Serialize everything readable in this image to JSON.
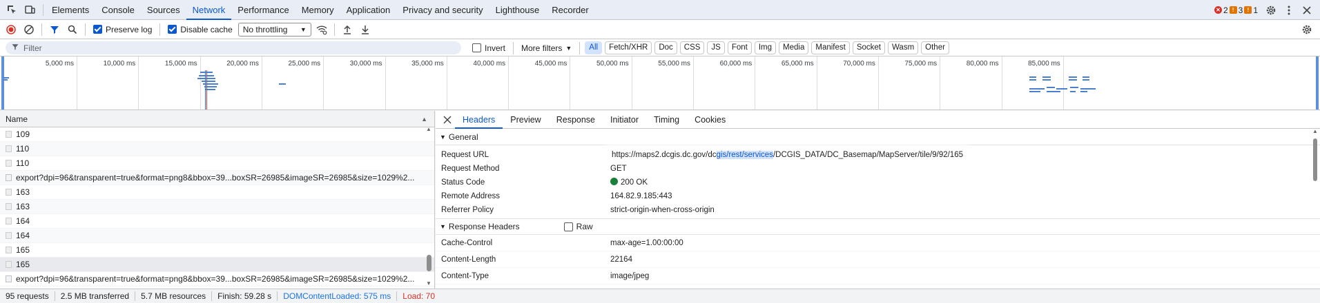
{
  "tabs": [
    "Elements",
    "Console",
    "Sources",
    "Network",
    "Performance",
    "Memory",
    "Application",
    "Privacy and security",
    "Lighthouse",
    "Recorder"
  ],
  "active_tab": "Network",
  "issues": {
    "errors": "2",
    "warnings": "3",
    "info": "1"
  },
  "toolbar": {
    "preserve_log": "Preserve log",
    "disable_cache": "Disable cache",
    "throttling": "No throttling"
  },
  "filter": {
    "placeholder": "Filter",
    "invert": "Invert",
    "more_filters": "More filters",
    "types": [
      "All",
      "Fetch/XHR",
      "Doc",
      "CSS",
      "JS",
      "Font",
      "Img",
      "Media",
      "Manifest",
      "Socket",
      "Wasm",
      "Other"
    ]
  },
  "overview_ticks": [
    "5,000 ms",
    "10,000 ms",
    "15,000 ms",
    "20,000 ms",
    "25,000 ms",
    "30,000 ms",
    "35,000 ms",
    "40,000 ms",
    "45,000 ms",
    "50,000 ms",
    "55,000 ms",
    "60,000 ms",
    "65,000 ms",
    "70,000 ms",
    "75,000 ms",
    "80,000 ms",
    "85,000 ms"
  ],
  "requests": {
    "header": "Name",
    "rows": [
      {
        "name": "109"
      },
      {
        "name": "110"
      },
      {
        "name": "110"
      },
      {
        "name": "export?dpi=96&transparent=true&format=png8&bbox=39...boxSR=26985&imageSR=26985&size=1029%2..."
      },
      {
        "name": "163"
      },
      {
        "name": "163"
      },
      {
        "name": "164"
      },
      {
        "name": "164"
      },
      {
        "name": "165"
      },
      {
        "name": "165"
      },
      {
        "name": "export?dpi=96&transparent=true&format=png8&bbox=39...boxSR=26985&imageSR=26985&size=1029%2..."
      }
    ]
  },
  "detail_tabs": [
    "Headers",
    "Preview",
    "Response",
    "Initiator",
    "Timing",
    "Cookies"
  ],
  "general": {
    "title": "General",
    "request_url_label": "Request URL",
    "request_url_pre": "https://maps2.dcgis.dc.gov/dc",
    "request_url_mid": "gis/rest/services",
    "request_url_post": "/DCGIS_DATA/DC_Basemap/MapServer/tile/9/92/165",
    "request_method_label": "Request Method",
    "request_method": "GET",
    "status_code_label": "Status Code",
    "status_code": "200 OK",
    "remote_address_label": "Remote Address",
    "remote_address": "164.82.9.185:443",
    "referrer_policy_label": "Referrer Policy",
    "referrer_policy": "strict-origin-when-cross-origin"
  },
  "response_headers": {
    "title": "Response Headers",
    "raw": "Raw",
    "items": [
      {
        "k": "Cache-Control",
        "v": "max-age=1.00:00:00"
      },
      {
        "k": "Content-Length",
        "v": "22164"
      },
      {
        "k": "Content-Type",
        "v": "image/jpeg"
      }
    ]
  },
  "status": {
    "requests": "95 requests",
    "transferred": "2.5 MB transferred",
    "resources": "5.7 MB resources",
    "finish": "Finish: 59.28 s",
    "dcl": "DOMContentLoaded: 575 ms",
    "load": "Load: 70"
  },
  "colors": {
    "accent": "#0b57d0",
    "dcl": "#1a73e8",
    "load": "#d93025",
    "status_ok": "#188038"
  }
}
